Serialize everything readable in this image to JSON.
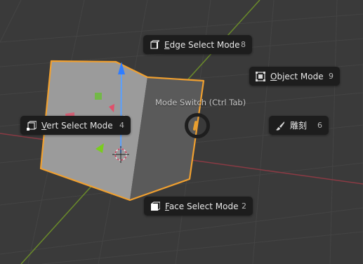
{
  "pie_menu": {
    "title": "Mode Switch (Ctrl Tab)",
    "items": [
      {
        "label_first": "E",
        "label_rest": "dge Select Mode",
        "key": "8",
        "icon": "edge-select-icon"
      },
      {
        "label_first": "O",
        "label_rest": "bject Mode",
        "key": "9",
        "icon": "object-mode-icon"
      },
      {
        "label_first": "V",
        "label_rest": "ert Select Mode",
        "key": "4",
        "icon": "vertex-select-icon"
      },
      {
        "label_first": "",
        "label_rest": "雕刻",
        "key": "6",
        "icon": "sculpt-brush-icon"
      },
      {
        "label_first": "F",
        "label_rest": "ace Select Mode",
        "key": "2",
        "icon": "face-select-icon"
      }
    ]
  },
  "colors": {
    "background": "#3a3a3a",
    "grid": "#444444",
    "x_axis": "#8a3a44",
    "y_axis": "#6a8a2a",
    "selection_outline": "#f0a030",
    "menu_bg": "#1d1d1d"
  }
}
